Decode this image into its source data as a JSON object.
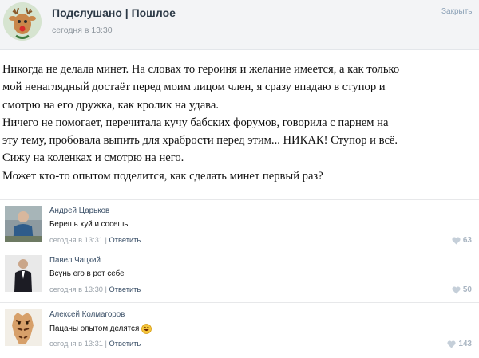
{
  "post": {
    "group_name": "Подслушано | Пошлое",
    "time": "сегодня в 13:30",
    "close_label": "Закрыть",
    "lines": [
      "Никогда не делала минет. На словах то героиня и желание имеется, а как только",
      "мой ненаглядный достаёт перед моим лицом член, я сразу впадаю в ступор и",
      "смотрю на его дружка, как кролик на удава.",
      "Ничего не помогает, перечитала кучу бабских форумов, говорила с парнем на",
      "эту тему, пробовала выпить для храбрости перед этим... НИКАК! Ступор и всё.",
      "Сижу на коленках и смотрю на него.",
      "Может кто-то опытом поделится, как сделать минет первый раз?"
    ]
  },
  "comments": [
    {
      "author": "Андрей Царьков",
      "text": "Берешь хуй и сосешь",
      "time": "сегодня в 13:31",
      "separator": " | ",
      "reply_label": "Ответить",
      "likes": "63",
      "has_smiley": false
    },
    {
      "author": "Павел Чацкий",
      "text": "Всунь его в рот себе",
      "time": "сегодня в 13:30",
      "separator": " | ",
      "reply_label": "Ответить",
      "likes": "50",
      "has_smiley": false
    },
    {
      "author": "Алексей Колмагоров",
      "text": "Пацаны опытом делятся",
      "time": "сегодня в 13:31",
      "separator": " | ",
      "reply_label": "Ответить",
      "likes": "143",
      "has_smiley": true
    }
  ],
  "icons": {
    "group_avatar": "deer-avatar-icon",
    "like": "heart-icon",
    "emoji": "smiley-icon"
  },
  "colors": {
    "header_bg": "#f3f4f6",
    "author_link": "#3a4f67",
    "meta_text": "#9aa2aa",
    "like_count": "#a9b5c2"
  }
}
